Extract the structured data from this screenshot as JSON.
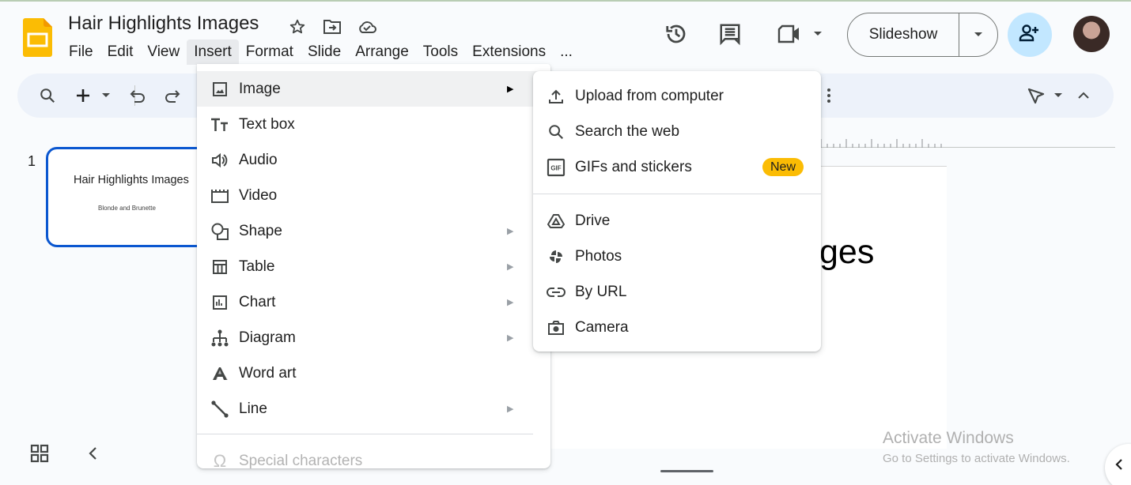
{
  "app": {
    "title": "Hair Highlights Images",
    "menubar": [
      "File",
      "Edit",
      "View",
      "Insert",
      "Format",
      "Slide",
      "Arrange",
      "Tools",
      "Extensions"
    ],
    "menubar_more": "...",
    "active_menu": "Insert",
    "brand_color": "#fbbc04"
  },
  "header": {
    "slideshow_label": "Slideshow",
    "title_icons": [
      "star-icon",
      "move-to-folder-icon",
      "cloud-saved-icon"
    ],
    "right_icons": [
      "version-history-icon",
      "comments-icon",
      "meet-video-icon",
      "share-icon",
      "avatar"
    ]
  },
  "toolbar": {
    "icons": [
      "search-icon",
      "new-slide-icon",
      "undo-icon",
      "redo-icon",
      "more-icon",
      "select-cursor-icon",
      "collapse-icon"
    ]
  },
  "filmstrip": {
    "slides": [
      {
        "number": "1",
        "title": "Hair Highlights Images",
        "subtitle": "Blonde and Brunette"
      }
    ]
  },
  "canvas": {
    "visible_text": "ges"
  },
  "insert_menu": {
    "items": [
      {
        "label": "Image",
        "icon": "image-icon",
        "submenu": true,
        "highlighted": true
      },
      {
        "label": "Text box",
        "icon": "text-box-icon",
        "submenu": false
      },
      {
        "label": "Audio",
        "icon": "audio-icon",
        "submenu": false
      },
      {
        "label": "Video",
        "icon": "video-icon",
        "submenu": false
      },
      {
        "label": "Shape",
        "icon": "shape-icon",
        "submenu": true
      },
      {
        "label": "Table",
        "icon": "table-icon",
        "submenu": true
      },
      {
        "label": "Chart",
        "icon": "chart-icon",
        "submenu": true
      },
      {
        "label": "Diagram",
        "icon": "diagram-icon",
        "submenu": true
      },
      {
        "label": "Word art",
        "icon": "word-art-icon",
        "submenu": false
      },
      {
        "label": "Line",
        "icon": "line-icon",
        "submenu": true
      }
    ],
    "special": {
      "label": "Special characters",
      "icon": "omega-icon",
      "disabled": true
    }
  },
  "image_submenu": {
    "items": [
      {
        "label": "Upload from computer",
        "icon": "upload-icon"
      },
      {
        "label": "Search the web",
        "icon": "search-icon"
      },
      {
        "label": "GIFs and stickers",
        "icon": "gif-icon",
        "badge": "New"
      },
      {
        "label": "Drive",
        "icon": "drive-icon"
      },
      {
        "label": "Photos",
        "icon": "photos-icon"
      },
      {
        "label": "By URL",
        "icon": "link-icon"
      },
      {
        "label": "Camera",
        "icon": "camera-icon"
      }
    ]
  },
  "watermark": {
    "line1": "Activate Windows",
    "line2": "Go to Settings to activate Windows."
  }
}
